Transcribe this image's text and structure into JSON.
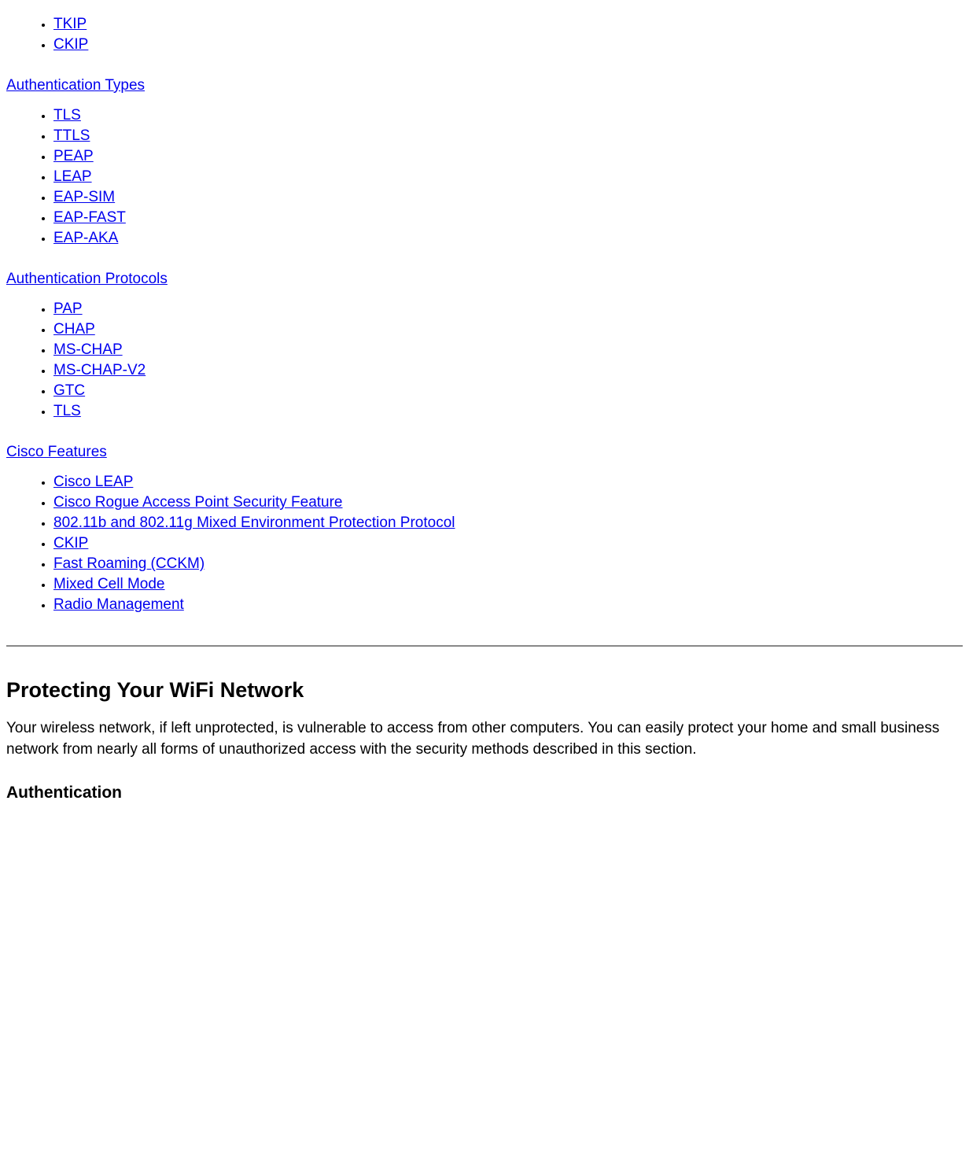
{
  "topList": {
    "items": [
      "TKIP",
      "CKIP"
    ]
  },
  "sections": [
    {
      "title": "Authentication Types",
      "items": [
        "TLS",
        "TTLS",
        "PEAP",
        "LEAP",
        "EAP-SIM",
        "EAP-FAST",
        "EAP-AKA"
      ]
    },
    {
      "title": "Authentication Protocols",
      "items": [
        "PAP",
        "CHAP",
        "MS-CHAP",
        "MS-CHAP-V2",
        "GTC",
        "TLS"
      ]
    },
    {
      "title": "Cisco Features",
      "items": [
        "Cisco LEAP",
        "Cisco Rogue Access Point Security Feature",
        "802.11b and 802.11g Mixed Environment Protection Protocol",
        "CKIP",
        "Fast Roaming (CCKM)",
        "Mixed Cell Mode",
        "Radio Management"
      ]
    }
  ],
  "heading2": "Protecting Your WiFi Network",
  "paragraph": "Your wireless network, if left unprotected, is vulnerable to access from other computers. You can easily protect your home and small business network from nearly all forms of unauthorized access with the security methods described in this section.",
  "heading3": "Authentication"
}
